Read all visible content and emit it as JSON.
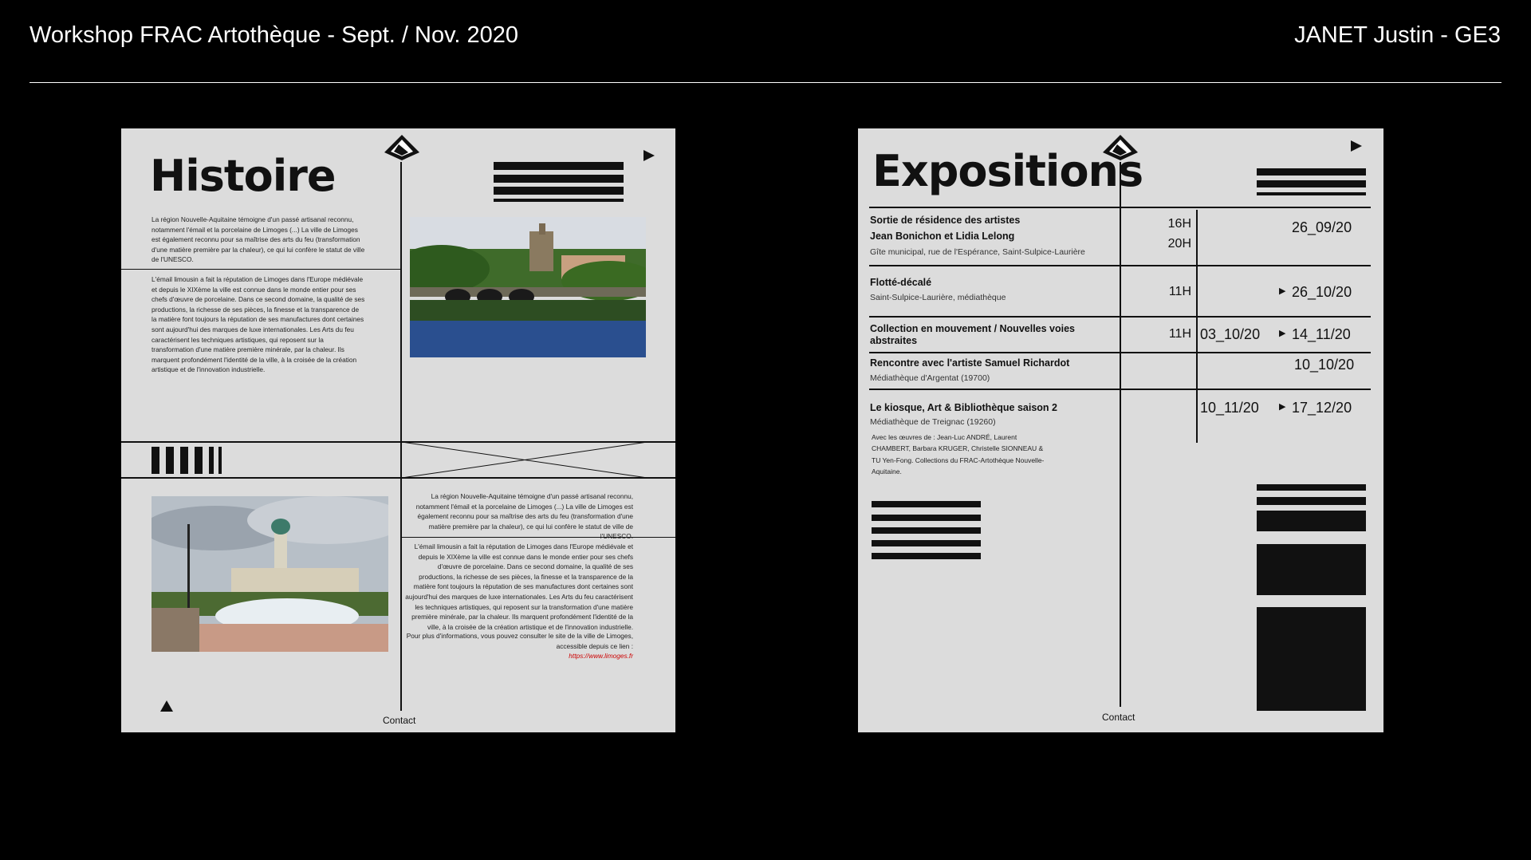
{
  "header": {
    "left": "Workshop FRAC Artothèque - Sept. / Nov. 2020",
    "right": "JANET Justin - GE3"
  },
  "histoire": {
    "title": "Histoire",
    "para1": "La région Nouvelle-Aquitaine témoigne d'un passé artisanal reconnu, notamment l'émail et la porcelaine de Limoges (...) La ville de Limoges est également reconnu pour sa maîtrise des arts du feu (transformation d'une matière première par la chaleur), ce qui lui confère le statut de ville de l'UNESCO.",
    "para2": "L'émail limousin a fait la réputation de Limoges dans l'Europe médiévale et depuis le XIXème la ville est connue dans le monde entier pour ses chefs d'œuvre de porcelaine. Dans ce second domaine, la qualité de ses productions, la richesse de ses pièces, la finesse et la transparence de la matière font toujours la réputation de ses manufactures dont certaines sont aujourd'hui des marques de luxe internationales. Les Arts du feu caractérisent les techniques artistiques, qui reposent sur la transformation d'une matière première minérale, par la chaleur. Ils marquent profondément l'identité de la ville, à la croisée de la création artistique et de l'innovation industrielle.",
    "para3": "La région Nouvelle-Aquitaine témoigne d'un passé artisanal reconnu, notamment l'émail et la porcelaine de Limoges (...) La ville de Limoges est également reconnu pour sa maîtrise des arts du feu (transformation d'une matière première par la chaleur), ce qui lui confère le statut de ville de l'UNESCO.",
    "para4": "L'émail limousin a fait la réputation de Limoges dans l'Europe médiévale et depuis le XIXème la ville est connue dans le monde entier pour ses chefs d'œuvre de porcelaine. Dans ce second domaine, la qualité de ses productions, la richesse de ses pièces, la finesse et la transparence de la matière font toujours la réputation de ses manufactures dont certaines sont aujourd'hui des marques de luxe internationales. Les Arts du feu caractérisent les techniques artistiques, qui reposent sur la transformation d'une matière première minérale, par la chaleur. Ils marquent profondément l'identité de la ville, à la croisée de la création artistique et de l'innovation industrielle.",
    "para5": "Pour plus d'informations, vous pouvez consulter le site de la ville de Limoges, accessible depuis ce lien :",
    "link": "https://www.limoges.fr",
    "contact": "Contact"
  },
  "expositions": {
    "title": "Expositions",
    "events": [
      {
        "title": "Sortie de résidence des artistes",
        "title2": "Jean Bonichon et Lidia Lelong",
        "sub": "Gîte municipal, rue de l'Espérance, Saint-Sulpice-Laurière",
        "time1": "16H",
        "time2": "20H",
        "date": "26_09/20"
      },
      {
        "title": "Flotté-décalé",
        "sub": "Saint-Sulpice-Laurière, médiathèque",
        "time1": "11H",
        "date": "26_10/20"
      },
      {
        "title": "Collection en mouvement / Nouvelles voies abstraites",
        "time1": "11H",
        "date_from": "03_10/20",
        "date": "14_11/20"
      },
      {
        "title": "Rencontre avec l'artiste Samuel Richardot",
        "sub": "Médiathèque d'Argentat (19700)",
        "date": "10_10/20"
      },
      {
        "title": "Le kiosque, Art & Bibliothèque saison 2",
        "sub": "Médiathèque de Treignac (19260)",
        "date_from": "10_11/20",
        "date": "17_12/20",
        "note": "Avec les œuvres de : Jean-Luc ANDRÉ, Laurent CHAMBERT, Barbara KRUGER, Christelle SIONNEAU & TU Yen-Fong. Collections du FRAC-Artothèque Nouvelle-Aquitaine."
      }
    ],
    "contact": "Contact"
  },
  "icons": [
    "logo-icon",
    "play-arrow-icon",
    "triangle-up-icon"
  ]
}
